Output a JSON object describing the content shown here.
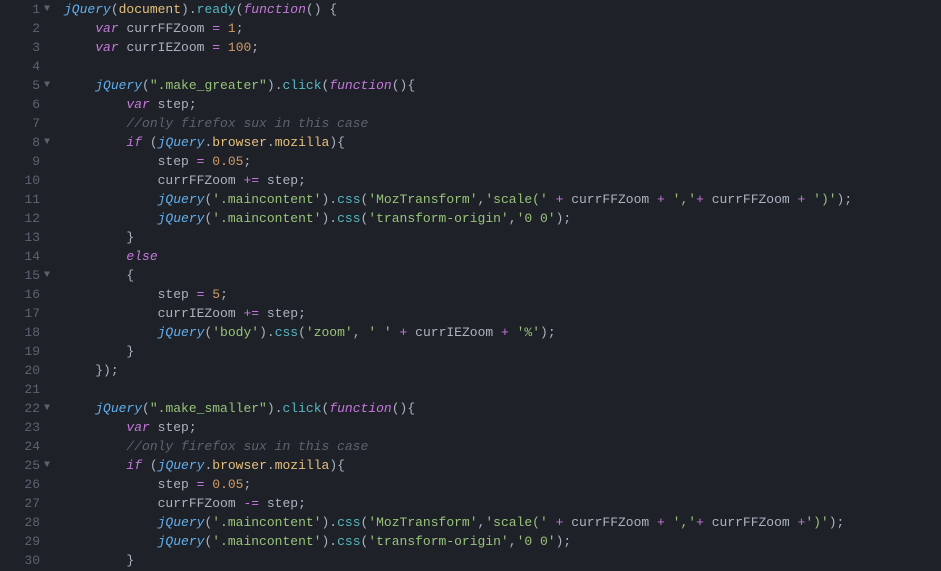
{
  "editor": {
    "lines": [
      {
        "num": "1",
        "fold": true,
        "indent": 0,
        "tokens": [
          [
            "func",
            "jQuery"
          ],
          [
            "paren",
            "("
          ],
          [
            "prop",
            "document"
          ],
          [
            "paren",
            ")"
          ],
          [
            "punc",
            "."
          ],
          [
            "method",
            "ready"
          ],
          [
            "paren",
            "("
          ],
          [
            "key",
            "function"
          ],
          [
            "paren",
            "() {"
          ]
        ]
      },
      {
        "num": "2",
        "fold": false,
        "indent": 1,
        "tokens": [
          [
            "key",
            "var"
          ],
          [
            "punc",
            " "
          ],
          [
            "ident",
            "currFFZoom"
          ],
          [
            "punc",
            " "
          ],
          [
            "op",
            "="
          ],
          [
            "punc",
            " "
          ],
          [
            "num",
            "1"
          ],
          [
            "punc",
            ";"
          ]
        ]
      },
      {
        "num": "3",
        "fold": false,
        "indent": 1,
        "tokens": [
          [
            "key",
            "var"
          ],
          [
            "punc",
            " "
          ],
          [
            "ident",
            "currIEZoom"
          ],
          [
            "punc",
            " "
          ],
          [
            "op",
            "="
          ],
          [
            "punc",
            " "
          ],
          [
            "num",
            "100"
          ],
          [
            "punc",
            ";"
          ]
        ]
      },
      {
        "num": "4",
        "fold": false,
        "indent": 0,
        "tokens": []
      },
      {
        "num": "5",
        "fold": true,
        "indent": 1,
        "tokens": [
          [
            "func",
            "jQuery"
          ],
          [
            "paren",
            "("
          ],
          [
            "str",
            "\".make_greater\""
          ],
          [
            "paren",
            ")"
          ],
          [
            "punc",
            "."
          ],
          [
            "method",
            "click"
          ],
          [
            "paren",
            "("
          ],
          [
            "key",
            "function"
          ],
          [
            "paren",
            "(){"
          ]
        ]
      },
      {
        "num": "6",
        "fold": false,
        "indent": 2,
        "tokens": [
          [
            "key",
            "var"
          ],
          [
            "punc",
            " "
          ],
          [
            "ident",
            "step"
          ],
          [
            "punc",
            ";"
          ]
        ]
      },
      {
        "num": "7",
        "fold": false,
        "indent": 2,
        "tokens": [
          [
            "comment",
            "//only firefox sux in this case"
          ]
        ]
      },
      {
        "num": "8",
        "fold": true,
        "indent": 2,
        "tokens": [
          [
            "key",
            "if"
          ],
          [
            "punc",
            " "
          ],
          [
            "paren",
            "("
          ],
          [
            "func",
            "jQuery"
          ],
          [
            "punc",
            "."
          ],
          [
            "prop",
            "browser"
          ],
          [
            "punc",
            "."
          ],
          [
            "prop",
            "mozilla"
          ],
          [
            "paren",
            ")"
          ],
          [
            "brace",
            "{"
          ]
        ]
      },
      {
        "num": "9",
        "fold": false,
        "indent": 3,
        "tokens": [
          [
            "ident",
            "step"
          ],
          [
            "punc",
            " "
          ],
          [
            "op",
            "="
          ],
          [
            "punc",
            " "
          ],
          [
            "num",
            "0.05"
          ],
          [
            "punc",
            ";"
          ]
        ]
      },
      {
        "num": "10",
        "fold": false,
        "indent": 3,
        "tokens": [
          [
            "ident",
            "currFFZoom"
          ],
          [
            "punc",
            " "
          ],
          [
            "op",
            "+="
          ],
          [
            "punc",
            " "
          ],
          [
            "ident",
            "step"
          ],
          [
            "punc",
            ";"
          ]
        ]
      },
      {
        "num": "11",
        "fold": false,
        "indent": 3,
        "tokens": [
          [
            "func",
            "jQuery"
          ],
          [
            "paren",
            "("
          ],
          [
            "str",
            "'.maincontent'"
          ],
          [
            "paren",
            ")"
          ],
          [
            "punc",
            "."
          ],
          [
            "method",
            "css"
          ],
          [
            "paren",
            "("
          ],
          [
            "str",
            "'MozTransform'"
          ],
          [
            "punc",
            ","
          ],
          [
            "str",
            "'scale('"
          ],
          [
            "punc",
            " "
          ],
          [
            "op",
            "+"
          ],
          [
            "punc",
            " "
          ],
          [
            "ident",
            "currFFZoom"
          ],
          [
            "punc",
            " "
          ],
          [
            "op",
            "+"
          ],
          [
            "punc",
            " "
          ],
          [
            "str",
            "','"
          ],
          [
            "op",
            "+"
          ],
          [
            "punc",
            " "
          ],
          [
            "ident",
            "currFFZoom"
          ],
          [
            "punc",
            " "
          ],
          [
            "op",
            "+"
          ],
          [
            "punc",
            " "
          ],
          [
            "str",
            "')'"
          ],
          [
            "paren",
            ")"
          ],
          [
            "punc",
            ";"
          ]
        ]
      },
      {
        "num": "12",
        "fold": false,
        "indent": 3,
        "tokens": [
          [
            "func",
            "jQuery"
          ],
          [
            "paren",
            "("
          ],
          [
            "str",
            "'.maincontent'"
          ],
          [
            "paren",
            ")"
          ],
          [
            "punc",
            "."
          ],
          [
            "method",
            "css"
          ],
          [
            "paren",
            "("
          ],
          [
            "str",
            "'transform-origin'"
          ],
          [
            "punc",
            ","
          ],
          [
            "str",
            "'0 0'"
          ],
          [
            "paren",
            ")"
          ],
          [
            "punc",
            ";"
          ]
        ]
      },
      {
        "num": "13",
        "fold": false,
        "indent": 2,
        "tokens": [
          [
            "brace",
            "}"
          ]
        ]
      },
      {
        "num": "14",
        "fold": false,
        "indent": 2,
        "tokens": [
          [
            "key",
            "else"
          ]
        ]
      },
      {
        "num": "15",
        "fold": true,
        "indent": 2,
        "tokens": [
          [
            "brace",
            "{"
          ]
        ]
      },
      {
        "num": "16",
        "fold": false,
        "indent": 3,
        "tokens": [
          [
            "ident",
            "step"
          ],
          [
            "punc",
            " "
          ],
          [
            "op",
            "="
          ],
          [
            "punc",
            " "
          ],
          [
            "num",
            "5"
          ],
          [
            "punc",
            ";"
          ]
        ]
      },
      {
        "num": "17",
        "fold": false,
        "indent": 3,
        "tokens": [
          [
            "ident",
            "currIEZoom"
          ],
          [
            "punc",
            " "
          ],
          [
            "op",
            "+="
          ],
          [
            "punc",
            " "
          ],
          [
            "ident",
            "step"
          ],
          [
            "punc",
            ";"
          ]
        ]
      },
      {
        "num": "18",
        "fold": false,
        "indent": 3,
        "tokens": [
          [
            "func",
            "jQuery"
          ],
          [
            "paren",
            "("
          ],
          [
            "str",
            "'body'"
          ],
          [
            "paren",
            ")"
          ],
          [
            "punc",
            "."
          ],
          [
            "method",
            "css"
          ],
          [
            "paren",
            "("
          ],
          [
            "str",
            "'zoom'"
          ],
          [
            "punc",
            ", "
          ],
          [
            "str",
            "' '"
          ],
          [
            "punc",
            " "
          ],
          [
            "op",
            "+"
          ],
          [
            "punc",
            " "
          ],
          [
            "ident",
            "currIEZoom"
          ],
          [
            "punc",
            " "
          ],
          [
            "op",
            "+"
          ],
          [
            "punc",
            " "
          ],
          [
            "str",
            "'%'"
          ],
          [
            "paren",
            ")"
          ],
          [
            "punc",
            ";"
          ]
        ]
      },
      {
        "num": "19",
        "fold": false,
        "indent": 2,
        "tokens": [
          [
            "brace",
            "}"
          ]
        ]
      },
      {
        "num": "20",
        "fold": false,
        "indent": 1,
        "tokens": [
          [
            "brace",
            "}"
          ],
          [
            "paren",
            ")"
          ],
          [
            "punc",
            ";"
          ]
        ]
      },
      {
        "num": "21",
        "fold": false,
        "indent": 0,
        "tokens": []
      },
      {
        "num": "22",
        "fold": true,
        "indent": 1,
        "tokens": [
          [
            "func",
            "jQuery"
          ],
          [
            "paren",
            "("
          ],
          [
            "str",
            "\".make_smaller\""
          ],
          [
            "paren",
            ")"
          ],
          [
            "punc",
            "."
          ],
          [
            "method",
            "click"
          ],
          [
            "paren",
            "("
          ],
          [
            "key",
            "function"
          ],
          [
            "paren",
            "(){"
          ]
        ]
      },
      {
        "num": "23",
        "fold": false,
        "indent": 2,
        "tokens": [
          [
            "key",
            "var"
          ],
          [
            "punc",
            " "
          ],
          [
            "ident",
            "step"
          ],
          [
            "punc",
            ";"
          ]
        ]
      },
      {
        "num": "24",
        "fold": false,
        "indent": 2,
        "tokens": [
          [
            "comment",
            "//only firefox sux in this case"
          ]
        ]
      },
      {
        "num": "25",
        "fold": true,
        "indent": 2,
        "tokens": [
          [
            "key",
            "if"
          ],
          [
            "punc",
            " "
          ],
          [
            "paren",
            "("
          ],
          [
            "func",
            "jQuery"
          ],
          [
            "punc",
            "."
          ],
          [
            "prop",
            "browser"
          ],
          [
            "punc",
            "."
          ],
          [
            "prop",
            "mozilla"
          ],
          [
            "paren",
            ")"
          ],
          [
            "brace",
            "{"
          ]
        ]
      },
      {
        "num": "26",
        "fold": false,
        "indent": 3,
        "tokens": [
          [
            "ident",
            "step"
          ],
          [
            "punc",
            " "
          ],
          [
            "op",
            "="
          ],
          [
            "punc",
            " "
          ],
          [
            "num",
            "0.05"
          ],
          [
            "punc",
            ";"
          ]
        ]
      },
      {
        "num": "27",
        "fold": false,
        "indent": 3,
        "tokens": [
          [
            "ident",
            "currFFZoom"
          ],
          [
            "punc",
            " "
          ],
          [
            "op",
            "-="
          ],
          [
            "punc",
            " "
          ],
          [
            "ident",
            "step"
          ],
          [
            "punc",
            ";"
          ]
        ]
      },
      {
        "num": "28",
        "fold": false,
        "indent": 3,
        "tokens": [
          [
            "func",
            "jQuery"
          ],
          [
            "paren",
            "("
          ],
          [
            "str",
            "'.maincontent'"
          ],
          [
            "paren",
            ")"
          ],
          [
            "punc",
            "."
          ],
          [
            "method",
            "css"
          ],
          [
            "paren",
            "("
          ],
          [
            "str",
            "'MozTransform'"
          ],
          [
            "punc",
            ","
          ],
          [
            "str",
            "'scale('"
          ],
          [
            "punc",
            " "
          ],
          [
            "op",
            "+"
          ],
          [
            "punc",
            " "
          ],
          [
            "ident",
            "currFFZoom"
          ],
          [
            "punc",
            " "
          ],
          [
            "op",
            "+"
          ],
          [
            "punc",
            " "
          ],
          [
            "str",
            "','"
          ],
          [
            "op",
            "+"
          ],
          [
            "punc",
            " "
          ],
          [
            "ident",
            "currFFZoom"
          ],
          [
            "punc",
            " "
          ],
          [
            "op",
            "+"
          ],
          [
            "str",
            "')'"
          ],
          [
            "paren",
            ")"
          ],
          [
            "punc",
            ";"
          ]
        ]
      },
      {
        "num": "29",
        "fold": false,
        "indent": 3,
        "tokens": [
          [
            "func",
            "jQuery"
          ],
          [
            "paren",
            "("
          ],
          [
            "str",
            "'.maincontent'"
          ],
          [
            "paren",
            ")"
          ],
          [
            "punc",
            "."
          ],
          [
            "method",
            "css"
          ],
          [
            "paren",
            "("
          ],
          [
            "str",
            "'transform-origin'"
          ],
          [
            "punc",
            ","
          ],
          [
            "str",
            "'0 0'"
          ],
          [
            "paren",
            ")"
          ],
          [
            "punc",
            ";"
          ]
        ]
      },
      {
        "num": "30",
        "fold": false,
        "indent": 2,
        "tokens": [
          [
            "brace",
            "}"
          ]
        ]
      }
    ]
  }
}
